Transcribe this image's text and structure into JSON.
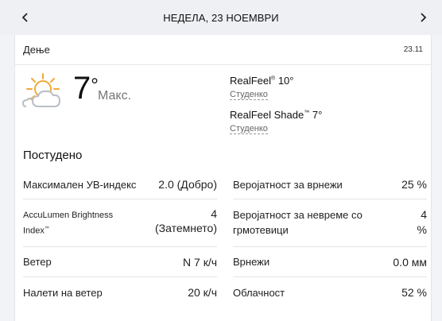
{
  "nav": {
    "title": "НЕДЕЛА, 23 НОЕМВРИ",
    "prev_icon": "chevron-left-icon",
    "next_icon": "chevron-right-icon"
  },
  "card": {
    "label": "Дење",
    "date": "23.11"
  },
  "current": {
    "icon": "partly-sunny-icon",
    "temp": "7",
    "deg": "°",
    "temp_label": "Макс.",
    "realfeel_name": "RealFeel",
    "realfeel_value": "10°",
    "realfeel_desc": "Студенко",
    "realfeel_shade_name": "RealFeel Shade",
    "realfeel_shade_value": "7°",
    "realfeel_shade_desc": "Студенко"
  },
  "summary": "Постудено",
  "details_left": [
    {
      "label": "Максимален УВ-индекс",
      "value": "2.0 (Добро)"
    },
    {
      "label_1": "AccuLumen Brightness",
      "label_2": "Index",
      "value_1": "4",
      "value_2": "(Затемнето)"
    },
    {
      "label": "Ветер",
      "value": "N 7 к/ч"
    },
    {
      "label": "Налети на ветер",
      "value": "20 к/ч"
    }
  ],
  "details_right": [
    {
      "label": "Веројатност за врнежи",
      "value": "25 %"
    },
    {
      "label_1": "Веројатност за невреме со",
      "label_2": "грмотевици",
      "value_1": "4",
      "value_2": "%"
    },
    {
      "label": "Врнежи",
      "value": "0.0 мм"
    },
    {
      "label": "Облачност",
      "value": "52 %"
    }
  ],
  "colors": {
    "sun": "#f2a93b",
    "cloud": "#b9bec5",
    "background": "#f1f3f6",
    "card": "#ffffff"
  }
}
